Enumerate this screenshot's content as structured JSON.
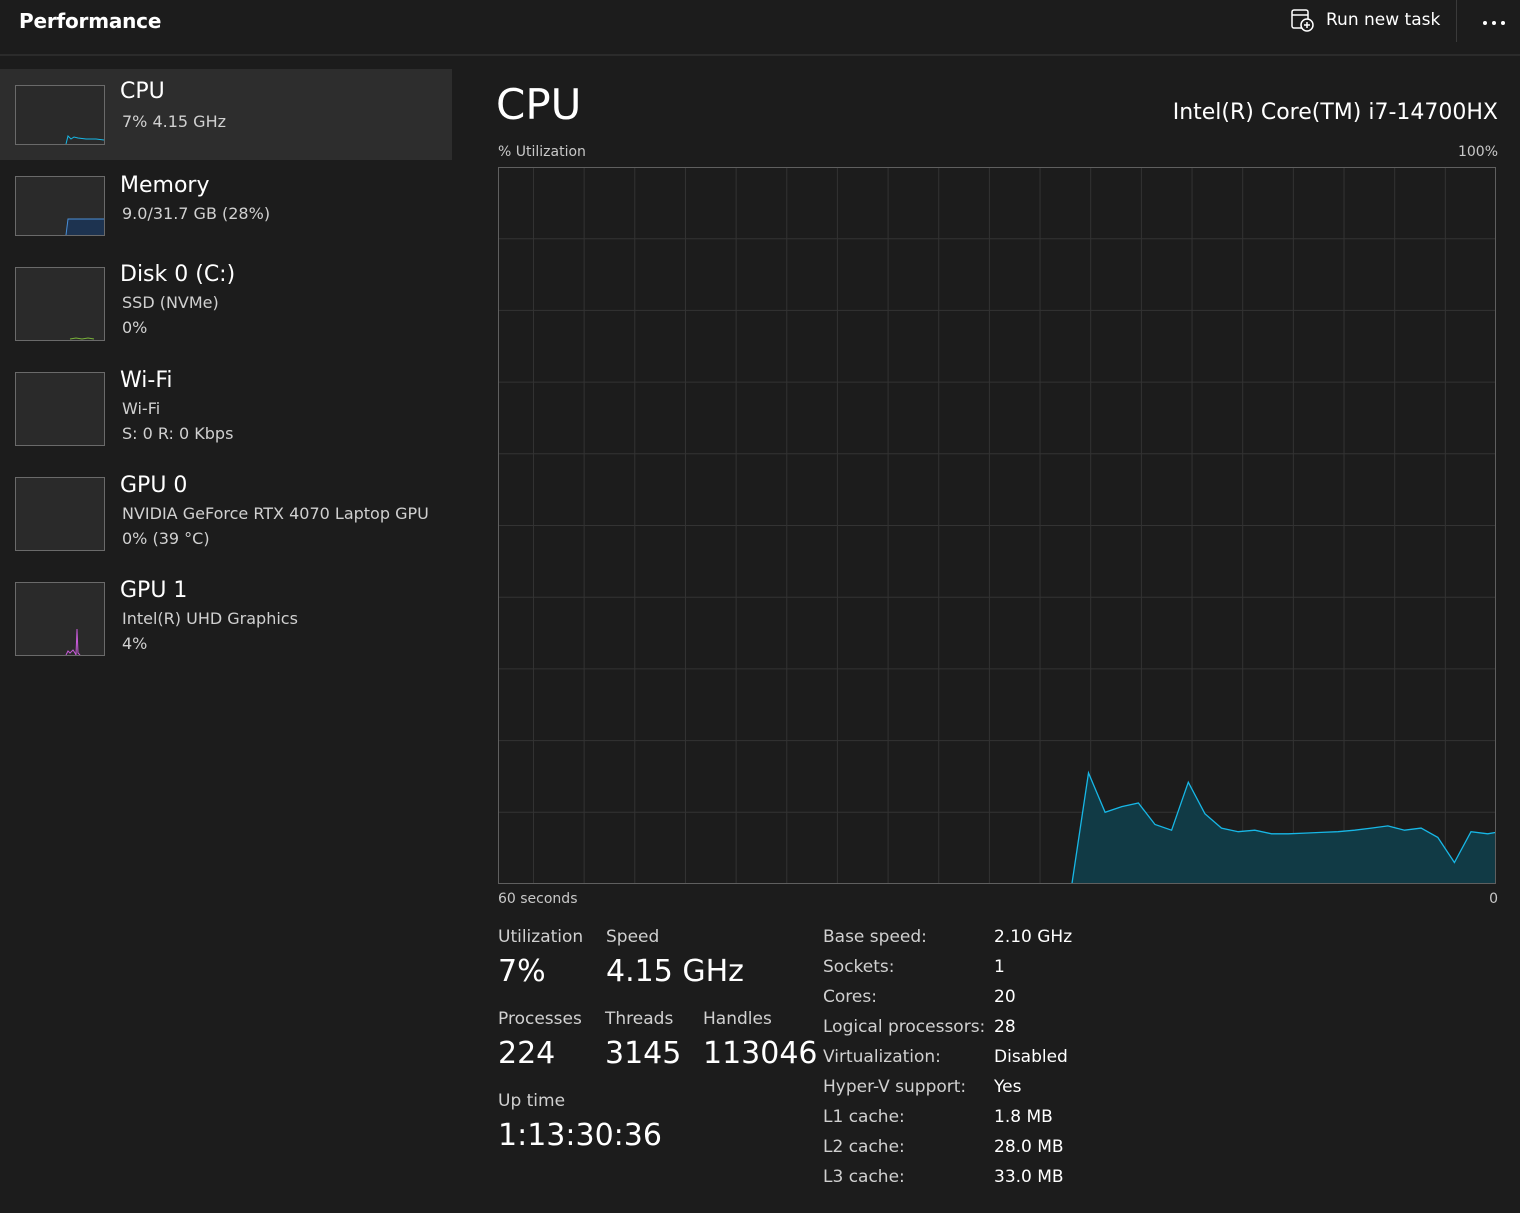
{
  "header": {
    "title": "Performance",
    "run_task_label": "Run new task",
    "more_icon": "ellipsis-icon"
  },
  "sidebar": {
    "items": [
      {
        "name": "CPU",
        "lines": [
          "7%  4.15 GHz"
        ],
        "graph_color": "#17b7e6",
        "selected": true
      },
      {
        "name": "Memory",
        "lines": [
          "9.0/31.7 GB (28%)"
        ],
        "graph_color": "#4a8fd6",
        "selected": false
      },
      {
        "name": "Disk 0 (C:)",
        "lines": [
          "SSD (NVMe)",
          "0%"
        ],
        "graph_color": "#7ab33a",
        "selected": false
      },
      {
        "name": "Wi-Fi",
        "lines": [
          "Wi-Fi",
          "S: 0  R: 0 Kbps"
        ],
        "graph_color": "#c27b3a",
        "selected": false
      },
      {
        "name": "GPU 0",
        "lines": [
          "NVIDIA GeForce RTX 4070 Laptop GPU",
          "0%  (39 °C)"
        ],
        "graph_color": "#b44fd4",
        "selected": false
      },
      {
        "name": "GPU 1",
        "lines": [
          "Intel(R) UHD Graphics",
          "4%"
        ],
        "graph_color": "#c75ad8",
        "selected": false
      }
    ]
  },
  "main": {
    "title": "CPU",
    "model": "Intel(R) Core(TM) i7-14700HX",
    "graph": {
      "y_label": "% Utilization",
      "y_max_label": "100%",
      "x_left_label": "60 seconds",
      "x_right_label": "0"
    },
    "stats": {
      "utilization": {
        "label": "Utilization",
        "value": "7%"
      },
      "speed": {
        "label": "Speed",
        "value": "4.15 GHz"
      },
      "processes": {
        "label": "Processes",
        "value": "224"
      },
      "threads": {
        "label": "Threads",
        "value": "3145"
      },
      "handles": {
        "label": "Handles",
        "value": "113046"
      },
      "uptime": {
        "label": "Up time",
        "value": "1:13:30:36"
      }
    },
    "details": [
      {
        "key": "Base speed:",
        "value": "2.10 GHz"
      },
      {
        "key": "Sockets:",
        "value": "1"
      },
      {
        "key": "Cores:",
        "value": "20"
      },
      {
        "key": "Logical processors:",
        "value": "28"
      },
      {
        "key": "Virtualization:",
        "value": "Disabled"
      },
      {
        "key": "Hyper-V support:",
        "value": "Yes"
      },
      {
        "key": "L1 cache:",
        "value": "1.8 MB"
      },
      {
        "key": "L2 cache:",
        "value": "28.0 MB"
      },
      {
        "key": "L3 cache:",
        "value": "33.0 MB"
      }
    ]
  },
  "chart_data": {
    "type": "area",
    "y_label": "% Utilization",
    "ylim": [
      0,
      100
    ],
    "x_range_seconds": [
      60,
      0
    ],
    "line_color": "#17b7e6",
    "fill_color": "#113a45",
    "grid": true,
    "series": [
      {
        "x": [
          25.5,
          24.5,
          23.5,
          22.5,
          21.5,
          20.5,
          19.5,
          18.5,
          17.5,
          16.5,
          15.5,
          14.5,
          13.5,
          12.5,
          11.5,
          10.5,
          9.5,
          8.5,
          7.5,
          6.5,
          5.5,
          4.5,
          3.5,
          2.5,
          1.5,
          0.5,
          0
        ],
        "values": [
          0,
          15.5,
          10,
          10.8,
          11.3,
          8.3,
          7.5,
          14.2,
          9.8,
          7.8,
          7.3,
          7.5,
          7,
          7,
          7.1,
          7.2,
          7.3,
          7.5,
          7.8,
          8.1,
          7.5,
          7.8,
          6.5,
          3,
          7.3,
          7,
          7.2
        ]
      }
    ]
  }
}
